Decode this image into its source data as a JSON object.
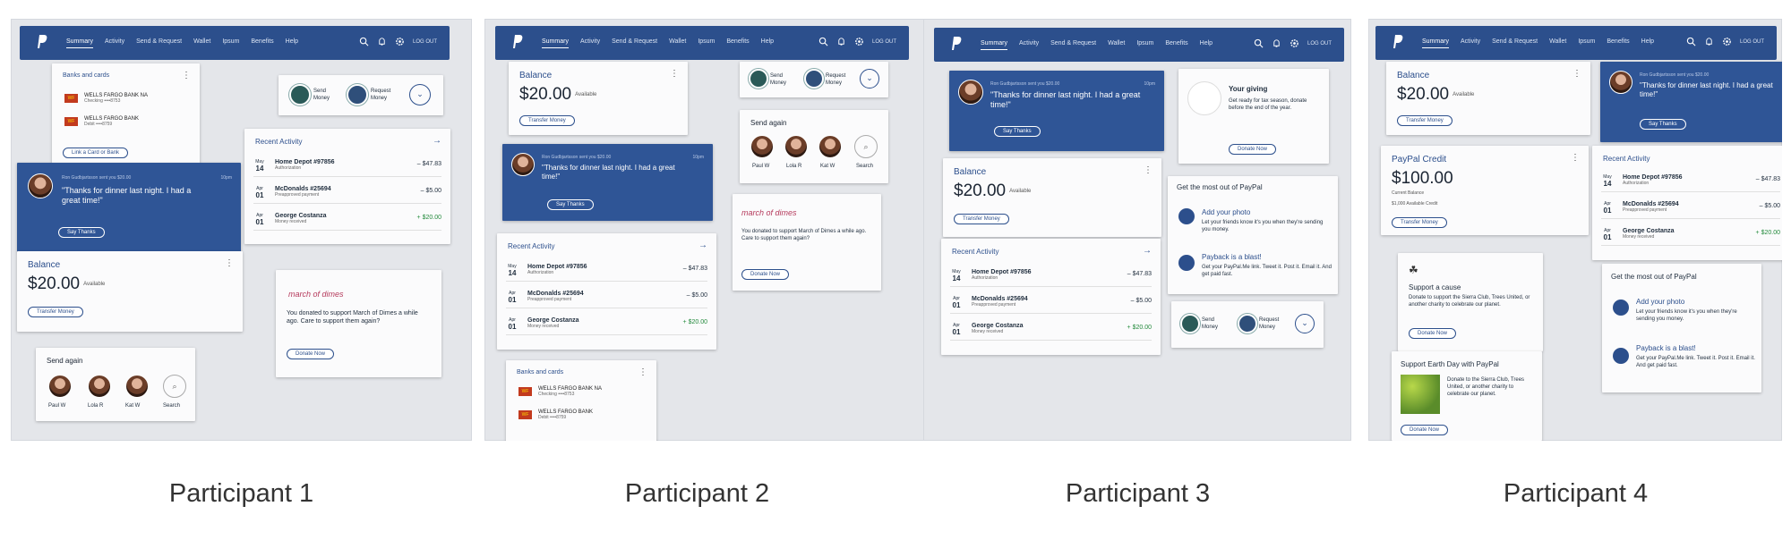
{
  "captions": [
    "Participant 1",
    "Participant 2",
    "Participant 3",
    "Participant 4"
  ],
  "nav": {
    "links": [
      "Summary",
      "Activity",
      "Send & Request",
      "Wallet",
      "Ipsum",
      "Benefits",
      "Help"
    ],
    "logout": "LOG OUT"
  },
  "balance": {
    "title": "Balance",
    "amount": "$20.00",
    "available": "Available",
    "button": "Transfer Money"
  },
  "credit": {
    "title": "PayPal Credit",
    "amount": "$100.00",
    "current": "Current Balance",
    "available": "$1,000 Available Credit",
    "button": "Transfer Money"
  },
  "banks": {
    "title": "Banks and cards",
    "rows": [
      {
        "logo": "WF",
        "name": "WELLS FARGO BANK NA",
        "sub": "Checking ••••8753"
      },
      {
        "logo": "WF",
        "name": "WELLS FARGO BANK",
        "sub": "Debit ••••8759"
      }
    ],
    "button": "Link a Card or Bank"
  },
  "message": {
    "from": "Ron Gudbjartsson sent you $20.00",
    "time": "10pm",
    "text": "\"Thanks for dinner last night. I had a great time!\"",
    "button": "Say Thanks"
  },
  "activity": {
    "title": "Recent Activity",
    "rows": [
      {
        "mon": "May",
        "day": "14",
        "name": "Home Depot #97856",
        "sub": "Authorization",
        "amount": "– $47.83",
        "pos": false
      },
      {
        "mon": "Apr",
        "day": "01",
        "name": "McDonalds #25694",
        "sub": "Preapproved payment",
        "amount": "– $5.00",
        "pos": false
      },
      {
        "mon": "Apr",
        "day": "01",
        "name": "George Costanza",
        "sub": "Money received",
        "amount": "+ $20.00",
        "pos": true
      }
    ]
  },
  "send_request": {
    "send": "Send Money",
    "request": "Request Money"
  },
  "send_again": {
    "title": "Send again",
    "people": [
      "Paul W",
      "Lola R",
      "Kat W"
    ],
    "search": "Search"
  },
  "dimes": {
    "logo": "march of dimes",
    "text": "You donated to support March of Dimes a while ago. Care to support them again?",
    "button": "Donate Now"
  },
  "giving": {
    "title": "Your giving",
    "text": "Get ready for tax season, donate before the end of the year.",
    "button": "Donate Now"
  },
  "most": {
    "title": "Get the most out of PayPal",
    "items": [
      {
        "title": "Add your photo",
        "text": "Let your friends know it's you when they're sending you money."
      },
      {
        "title": "Payback is a blast!",
        "text": "Get your PayPal.Me link. Tweet it. Post it. Email it. And get paid fast."
      }
    ]
  },
  "cause": {
    "title": "Support a cause",
    "text": "Donate to support the Sierra Club, Trees United, or another charity to celebrate our planet.",
    "button": "Donate Now"
  },
  "earth": {
    "title": "Support Earth Day with PayPal",
    "text": "Donate to the Sierra Club, Trees United, or another charity to celebrate our planet.",
    "button": "Donate Now"
  }
}
